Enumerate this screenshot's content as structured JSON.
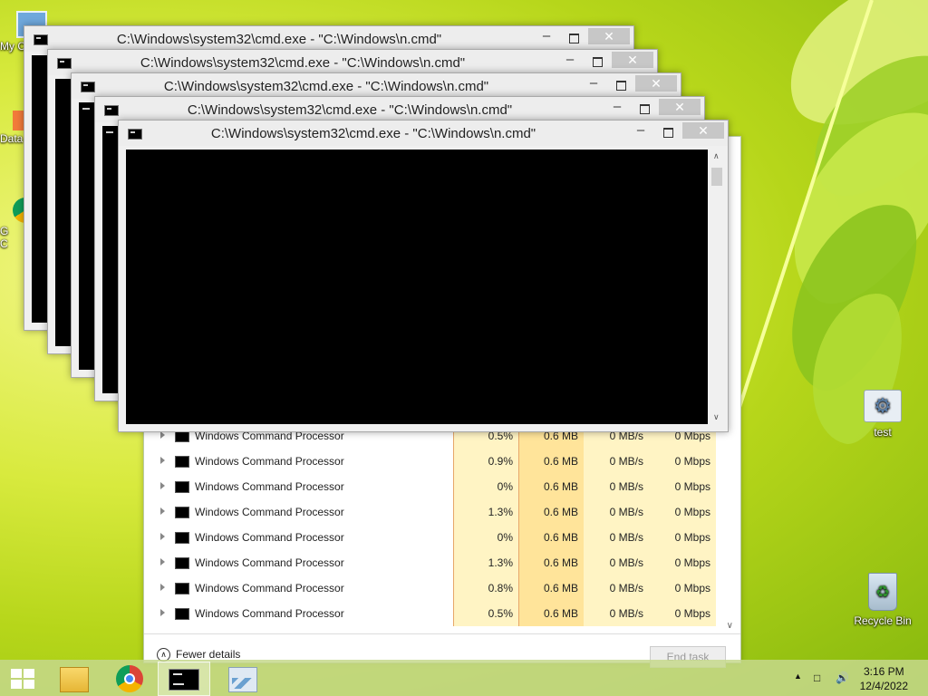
{
  "desktop": {
    "icons_left": [
      {
        "label": "My C",
        "icon": "computer-icon"
      },
      {
        "label": "Data",
        "icon": "shortcut-icon"
      },
      {
        "label": "G\nC",
        "icon": "chrome-icon"
      }
    ],
    "icons_right": [
      {
        "label": "test",
        "icon": "settings-gear-icon"
      },
      {
        "label": "Recycle Bin",
        "icon": "recycle-bin-icon"
      }
    ]
  },
  "cmd_windows": [
    {
      "title": "C:\\Windows\\system32\\cmd.exe - \"C:\\Windows\\n.cmd\""
    },
    {
      "title": "C:\\Windows\\system32\\cmd.exe - \"C:\\Windows\\n.cmd\""
    },
    {
      "title": "C:\\Windows\\system32\\cmd.exe - \"C:\\Windows\\n.cmd\""
    },
    {
      "title": "C:\\Windows\\system32\\cmd.exe - \"C:\\Windows\\n.cmd\""
    },
    {
      "title": "C:\\Windows\\system32\\cmd.exe - \"C:\\Windows\\n.cmd\""
    }
  ],
  "cmd_controls": {
    "minimize": "–",
    "close": "✕"
  },
  "task_manager": {
    "processes": [
      {
        "name": "Windows Command Processor",
        "cpu": "0.5%",
        "memory": "0.6 MB",
        "disk": "0 MB/s",
        "network": "0 Mbps"
      },
      {
        "name": "Windows Command Processor",
        "cpu": "0.9%",
        "memory": "0.6 MB",
        "disk": "0 MB/s",
        "network": "0 Mbps"
      },
      {
        "name": "Windows Command Processor",
        "cpu": "0%",
        "memory": "0.6 MB",
        "disk": "0 MB/s",
        "network": "0 Mbps"
      },
      {
        "name": "Windows Command Processor",
        "cpu": "1.3%",
        "memory": "0.6 MB",
        "disk": "0 MB/s",
        "network": "0 Mbps"
      },
      {
        "name": "Windows Command Processor",
        "cpu": "0%",
        "memory": "0.6 MB",
        "disk": "0 MB/s",
        "network": "0 Mbps"
      },
      {
        "name": "Windows Command Processor",
        "cpu": "1.3%",
        "memory": "0.6 MB",
        "disk": "0 MB/s",
        "network": "0 Mbps"
      },
      {
        "name": "Windows Command Processor",
        "cpu": "0.8%",
        "memory": "0.6 MB",
        "disk": "0 MB/s",
        "network": "0 Mbps"
      },
      {
        "name": "Windows Command Processor",
        "cpu": "0.5%",
        "memory": "0.6 MB",
        "disk": "0 MB/s",
        "network": "0 Mbps"
      }
    ],
    "fewer_details": "Fewer details",
    "end_task": "End task"
  },
  "taskbar": {
    "items": [
      {
        "icon": "windows-start-icon"
      },
      {
        "icon": "file-explorer-icon"
      },
      {
        "icon": "chrome-icon"
      },
      {
        "icon": "cmd-icon"
      },
      {
        "icon": "task-manager-icon"
      }
    ],
    "time": "3:16 PM",
    "date": "12/4/2022"
  }
}
